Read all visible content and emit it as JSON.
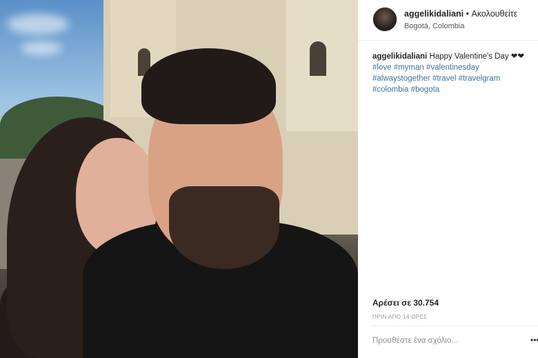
{
  "post": {
    "username": "aggelikidaliani",
    "separator": "•",
    "follow_label": "Ακολουθείτε",
    "location": "Bogotá, Colombia",
    "caption_text": "Happy Valentine's Day ❤❤",
    "hashtags": [
      "#love",
      "#myman",
      "#valentinesday",
      "#alwaystogether",
      "#travel",
      "#travelgram",
      "#colombia",
      "#bogota"
    ],
    "likes": "Αρέσει σε 30.754",
    "time_ago": "ΠΡΙΝ ΑΠΟ 14 ΩΡΕΣ",
    "comment_placeholder": "Προσθέστε ένα σχόλιο...",
    "more_icon": "more-options-icon"
  }
}
